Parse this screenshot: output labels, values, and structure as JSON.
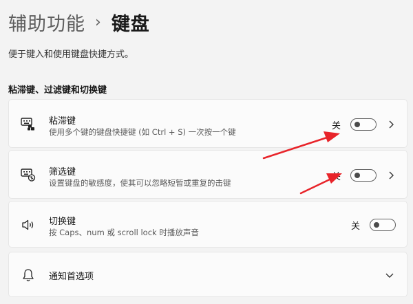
{
  "header": {
    "parent": "辅助功能",
    "separator": "›",
    "current": "键盘"
  },
  "description": "便于键入和使用键盘快捷方式。",
  "section_title": "粘滞键、过滤键和切换键",
  "settings": [
    {
      "title": "粘滞键",
      "subtitle": "使用多个键的键盘快捷键 (如 Ctrl + S) 一次按一个键",
      "state": "关",
      "icon": "sticky-keys-icon",
      "has_chevron": true
    },
    {
      "title": "筛选键",
      "subtitle": "设置键盘的敏感度，使其可以忽略短暂或重复的击键",
      "state": "关",
      "icon": "filter-keys-icon",
      "has_chevron": true
    },
    {
      "title": "切换键",
      "subtitle": "按 Caps、num 或 scroll lock 时播放声音",
      "state": "关",
      "icon": "toggle-keys-speaker-icon",
      "has_chevron": false
    }
  ],
  "notifications": {
    "title": "通知首选项",
    "icon": "bell-icon"
  },
  "annotation_color": "#e8242a"
}
